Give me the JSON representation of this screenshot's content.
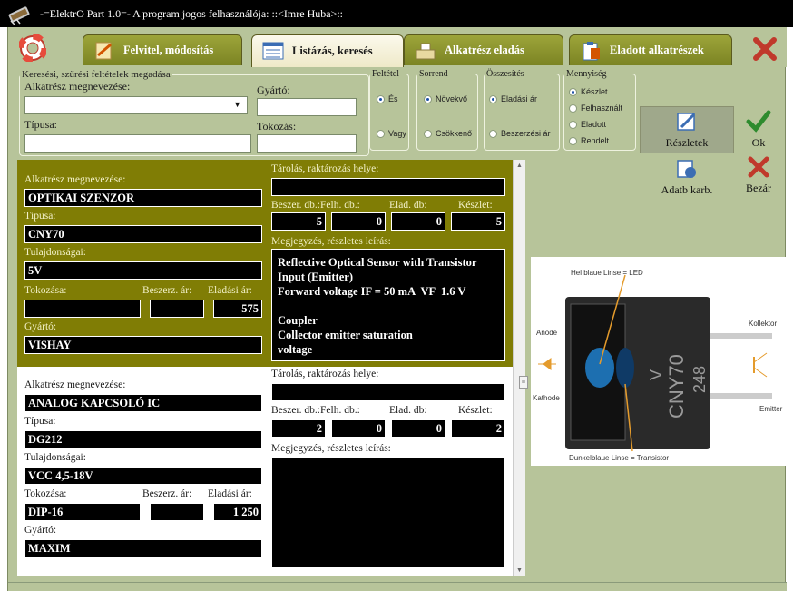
{
  "window": {
    "title": "-=ElektrO Part 1.0=-  A program jogos felhasználója:  ::<Imre Huba>::"
  },
  "tabs": [
    {
      "label": "Felvitel, módosítás",
      "active": false
    },
    {
      "label": "Listázás, keresés",
      "active": true
    },
    {
      "label": "Alkatrész eladás",
      "active": false
    },
    {
      "label": "Eladott alkatrészek",
      "active": false
    }
  ],
  "filter": {
    "legend": "Keresési, szűrési feltételek megadása",
    "name_label": "Alkatrész megnevezése:",
    "manufacturer_label": "Gyártó:",
    "type_label": "Típusa:",
    "package_label": "Tokozás:",
    "name_value": "",
    "manufacturer_value": "",
    "type_value": "",
    "package_value": ""
  },
  "condition": {
    "legend": "Feltétel",
    "options": [
      "És",
      "Vagy"
    ],
    "selected": "És"
  },
  "order": {
    "legend": "Sorrend",
    "options": [
      "Növekvő",
      "Csökkenő"
    ],
    "selected": "Növekvő"
  },
  "summary": {
    "legend": "Összesítés",
    "options": [
      "Eladási ár",
      "Beszerzési ár"
    ],
    "selected": "Eladási ár"
  },
  "quantity": {
    "legend": "Mennyiség",
    "options": [
      "Készlet",
      "Felhasznált",
      "Eladott",
      "Rendelt"
    ],
    "selected": "Készlet"
  },
  "actions": {
    "details": "Részletek",
    "ok": "Ok",
    "db_maint": "Adatb karb.",
    "close": "Bezár"
  },
  "labels": {
    "name": "Alkatrész megnevezése:",
    "type": "Típusa:",
    "props": "Tulajdonságai:",
    "package": "Tokozása:",
    "buy_price": "Beszerz. ár:",
    "sell_price": "Eladási ár:",
    "manufacturer": "Gyártó:",
    "storage": "Tárolás, raktározás helye:",
    "buy_qty": "Beszer. db.:",
    "used_qty": "Felh. db.:",
    "sold_qty": "Elad. db:",
    "stock": "Készlet:",
    "notes": "Megjegyzés, részletes leírás:"
  },
  "parts": [
    {
      "name": "OPTIKAI SZENZOR",
      "type": "CNY70",
      "props": "5V",
      "package": "",
      "buy_price": "",
      "sell_price": "575",
      "manufacturer": "VISHAY",
      "storage": "",
      "buy_qty": "5",
      "used_qty": "0",
      "sold_qty": "0",
      "stock": "5",
      "notes": "Reflective Optical Sensor with Transistor\nInput (Emitter)\nForward voltage IF = 50 mA  VF  1.6 V\n\nCoupler\nCollector emitter saturation\nvoltage"
    },
    {
      "name": "ANALOG KAPCSOLÓ IC",
      "type": "DG212",
      "props": "VCC 4,5-18V",
      "package": "DIP-16",
      "buy_price": "",
      "sell_price": "1 250",
      "manufacturer": "MAXIM",
      "storage": "",
      "buy_qty": "2",
      "used_qty": "0",
      "sold_qty": "0",
      "stock": "2",
      "notes": ""
    }
  ],
  "photo": {
    "label_led": "Hel blaue Linse = LED",
    "label_transistor": "Dunkelblaue Linse = Transistor",
    "label_anode": "Anode",
    "label_cathode": "Kathode",
    "label_collector": "Kollektor",
    "label_emitter": "Emitter",
    "chip_text_1": "CNY70",
    "chip_text_2": "248",
    "chip_text_3": "V"
  }
}
